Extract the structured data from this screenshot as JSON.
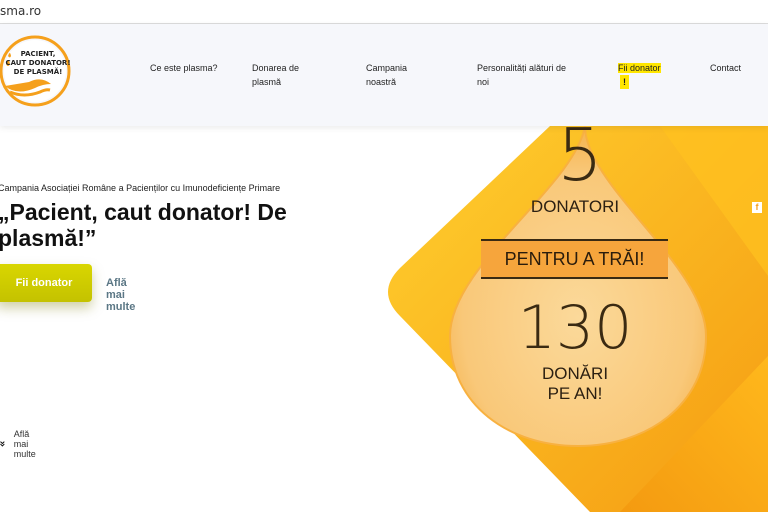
{
  "browser": {
    "url": "sma.ro"
  },
  "logo": {
    "text": "PACIENT, CAUT DONATOR! DE PLASMĂ!"
  },
  "nav": {
    "items": [
      {
        "label": "Ce este plasma?"
      },
      {
        "label": "Donarea de plasmă"
      },
      {
        "label": "Campania noastră"
      },
      {
        "label": "Personalități alături de noi"
      },
      {
        "label": "Fii donator",
        "badge": "!"
      },
      {
        "label": "Contact"
      }
    ]
  },
  "hero": {
    "subtitle": "Campania Asociației Române a Pacienților cu Imunodeficiențe Primare",
    "headline": "„Pacient, caut donator! De plasmă!”",
    "cta_label": "Fii donator",
    "more_link": "Află mai multe",
    "scroll_label": "Află mai multe"
  },
  "drop": {
    "donors_number": "5",
    "donors_label": "DONATORI",
    "banner": "PENTRU A TRĂI!",
    "donations_number": "130",
    "donations_label_1": "DONĂRI",
    "donations_label_2": "PE AN!"
  },
  "social": {
    "facebook": "f"
  },
  "colors": {
    "accent_yellow": "#ffe600",
    "orange": "#f7a21d",
    "button": "#d0ce00"
  }
}
